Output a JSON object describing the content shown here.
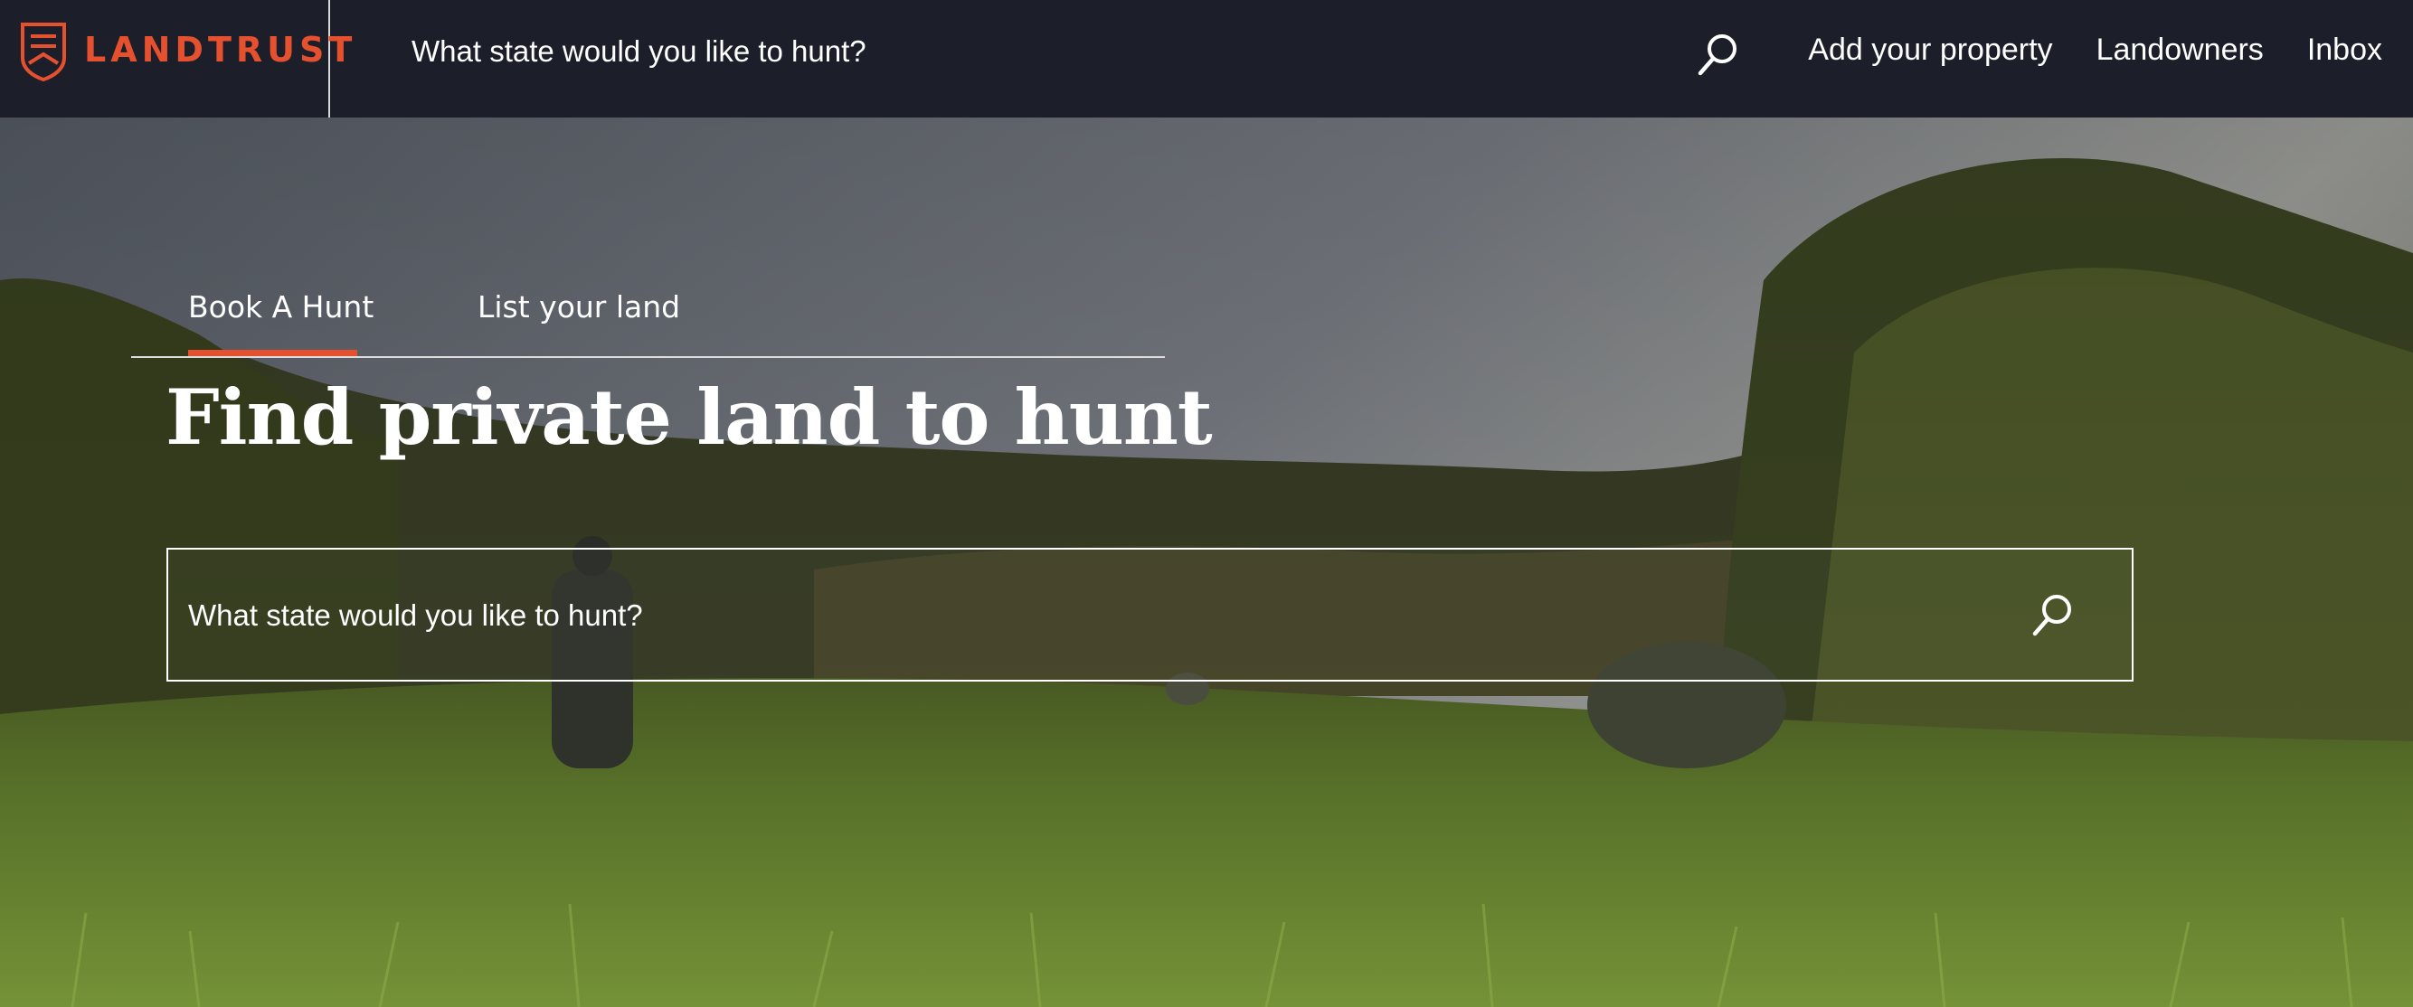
{
  "header": {
    "brand_name": "LANDTRUST",
    "search_placeholder": "What state would you like to hunt?",
    "search_icon": "search-icon",
    "links": [
      "Add your property",
      "Landowners",
      "Inbox"
    ]
  },
  "hero": {
    "tabs": [
      {
        "label": "Book A Hunt",
        "active": true
      },
      {
        "label": "List your land",
        "active": false
      }
    ],
    "title": "Find private land to hunt",
    "search": {
      "placeholder": "What state would you like to hunt?",
      "icon": "search-icon"
    }
  },
  "colors": {
    "accent": "#e5502f",
    "nav_background": "#1c1f2a"
  }
}
